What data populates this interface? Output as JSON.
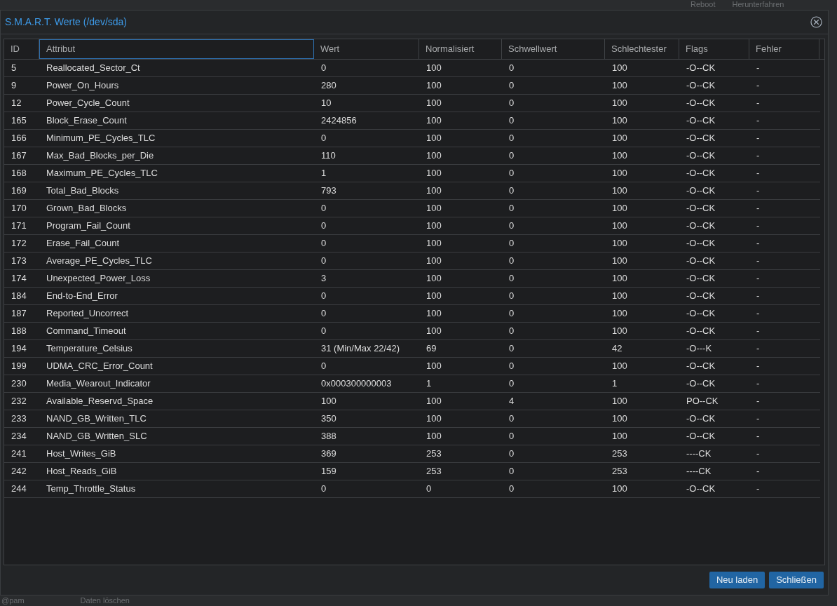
{
  "background": {
    "toolbar": [
      "Reboot",
      "Herunterfahren"
    ],
    "bottom_row": [
      "@pam",
      "Daten löschen"
    ]
  },
  "dialog": {
    "title": "S.M.A.R.T. Werte (/dev/sda)",
    "table": {
      "columns": [
        {
          "label": "ID",
          "focused": false
        },
        {
          "label": "Attribut",
          "focused": true
        },
        {
          "label": "Wert",
          "focused": false
        },
        {
          "label": "Normalisiert",
          "focused": false
        },
        {
          "label": "Schwellwert",
          "focused": false
        },
        {
          "label": "Schlechtester",
          "focused": false
        },
        {
          "label": "Flags",
          "focused": false
        },
        {
          "label": "Fehler",
          "focused": false
        }
      ],
      "rows": [
        [
          "5",
          "Reallocated_Sector_Ct",
          "0",
          "100",
          "0",
          "100",
          "-O--CK",
          "-"
        ],
        [
          "9",
          "Power_On_Hours",
          "280",
          "100",
          "0",
          "100",
          "-O--CK",
          "-"
        ],
        [
          "12",
          "Power_Cycle_Count",
          "10",
          "100",
          "0",
          "100",
          "-O--CK",
          "-"
        ],
        [
          "165",
          "Block_Erase_Count",
          "2424856",
          "100",
          "0",
          "100",
          "-O--CK",
          "-"
        ],
        [
          "166",
          "Minimum_PE_Cycles_TLC",
          "0",
          "100",
          "0",
          "100",
          "-O--CK",
          "-"
        ],
        [
          "167",
          "Max_Bad_Blocks_per_Die",
          "110",
          "100",
          "0",
          "100",
          "-O--CK",
          "-"
        ],
        [
          "168",
          "Maximum_PE_Cycles_TLC",
          "1",
          "100",
          "0",
          "100",
          "-O--CK",
          "-"
        ],
        [
          "169",
          "Total_Bad_Blocks",
          "793",
          "100",
          "0",
          "100",
          "-O--CK",
          "-"
        ],
        [
          "170",
          "Grown_Bad_Blocks",
          "0",
          "100",
          "0",
          "100",
          "-O--CK",
          "-"
        ],
        [
          "171",
          "Program_Fail_Count",
          "0",
          "100",
          "0",
          "100",
          "-O--CK",
          "-"
        ],
        [
          "172",
          "Erase_Fail_Count",
          "0",
          "100",
          "0",
          "100",
          "-O--CK",
          "-"
        ],
        [
          "173",
          "Average_PE_Cycles_TLC",
          "0",
          "100",
          "0",
          "100",
          "-O--CK",
          "-"
        ],
        [
          "174",
          "Unexpected_Power_Loss",
          "3",
          "100",
          "0",
          "100",
          "-O--CK",
          "-"
        ],
        [
          "184",
          "End-to-End_Error",
          "0",
          "100",
          "0",
          "100",
          "-O--CK",
          "-"
        ],
        [
          "187",
          "Reported_Uncorrect",
          "0",
          "100",
          "0",
          "100",
          "-O--CK",
          "-"
        ],
        [
          "188",
          "Command_Timeout",
          "0",
          "100",
          "0",
          "100",
          "-O--CK",
          "-"
        ],
        [
          "194",
          "Temperature_Celsius",
          "31 (Min/Max 22/42)",
          "69",
          "0",
          "42",
          "-O---K",
          "-"
        ],
        [
          "199",
          "UDMA_CRC_Error_Count",
          "0",
          "100",
          "0",
          "100",
          "-O--CK",
          "-"
        ],
        [
          "230",
          "Media_Wearout_Indicator",
          "0x000300000003",
          "1",
          "0",
          "1",
          "-O--CK",
          "-"
        ],
        [
          "232",
          "Available_Reservd_Space",
          "100",
          "100",
          "4",
          "100",
          "PO--CK",
          "-"
        ],
        [
          "233",
          "NAND_GB_Written_TLC",
          "350",
          "100",
          "0",
          "100",
          "-O--CK",
          "-"
        ],
        [
          "234",
          "NAND_GB_Written_SLC",
          "388",
          "100",
          "0",
          "100",
          "-O--CK",
          "-"
        ],
        [
          "241",
          "Host_Writes_GiB",
          "369",
          "253",
          "0",
          "253",
          "----CK",
          "-"
        ],
        [
          "242",
          "Host_Reads_GiB",
          "159",
          "253",
          "0",
          "253",
          "----CK",
          "-"
        ],
        [
          "244",
          "Temp_Throttle_Status",
          "0",
          "0",
          "0",
          "100",
          "-O--CK",
          "-"
        ]
      ]
    },
    "buttons": [
      "Neu laden",
      "Schließen"
    ]
  }
}
